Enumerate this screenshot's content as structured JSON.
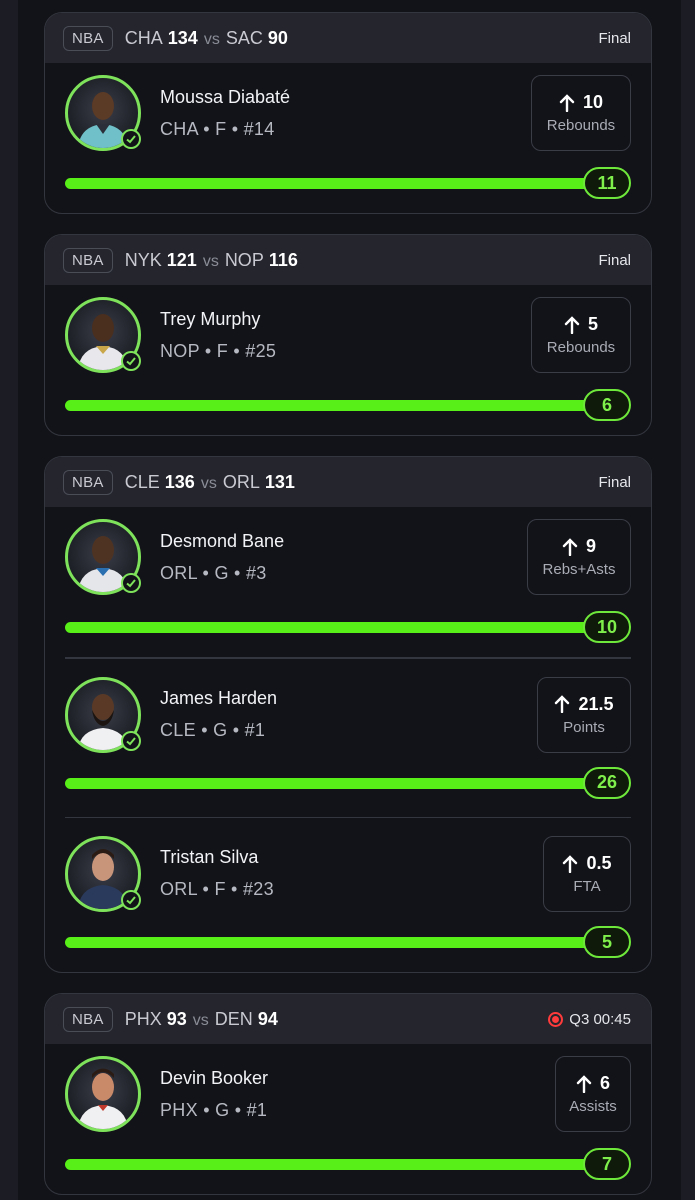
{
  "colors": {
    "accent": "#58ee17",
    "live": "#ff3b3b",
    "background": "#121318"
  },
  "cards": [
    {
      "league": "NBA",
      "home": "CHA",
      "home_score": "134",
      "vs": "vs",
      "away": "SAC",
      "away_score": "90",
      "status": "Final",
      "picks": [
        {
          "name": "Moussa Diabaté",
          "meta": "CHA • F • #14",
          "line": "10",
          "stat": "Rebounds",
          "result": "11",
          "progress": 1.0
        }
      ]
    },
    {
      "league": "NBA",
      "home": "NYK",
      "home_score": "121",
      "vs": "vs",
      "away": "NOP",
      "away_score": "116",
      "status": "Final",
      "picks": [
        {
          "name": "Trey Murphy",
          "meta": "NOP • F • #25",
          "line": "5",
          "stat": "Rebounds",
          "result": "6",
          "progress": 1.0
        }
      ]
    },
    {
      "league": "NBA",
      "home": "CLE",
      "home_score": "136",
      "vs": "vs",
      "away": "ORL",
      "away_score": "131",
      "status": "Final",
      "picks": [
        {
          "name": "Desmond Bane",
          "meta": "ORL • G • #3",
          "line": "9",
          "stat": "Rebs+Asts",
          "result": "10",
          "progress": 1.0
        },
        {
          "name": "James Harden",
          "meta": "CLE • G • #1",
          "line": "21.5",
          "stat": "Points",
          "result": "26",
          "progress": 1.0
        },
        {
          "name": "Tristan Silva",
          "meta": "ORL • F • #23",
          "line": "0.5",
          "stat": "FTA",
          "result": "5",
          "progress": 1.0
        }
      ]
    },
    {
      "league": "NBA",
      "home": "PHX",
      "home_score": "93",
      "vs": "vs",
      "away": "DEN",
      "away_score": "94",
      "status": "Q3 00:45",
      "live": true,
      "picks": [
        {
          "name": "Devin Booker",
          "meta": "PHX • G • #1",
          "line": "6",
          "stat": "Assists",
          "result": "7",
          "progress": 1.0
        }
      ]
    }
  ]
}
